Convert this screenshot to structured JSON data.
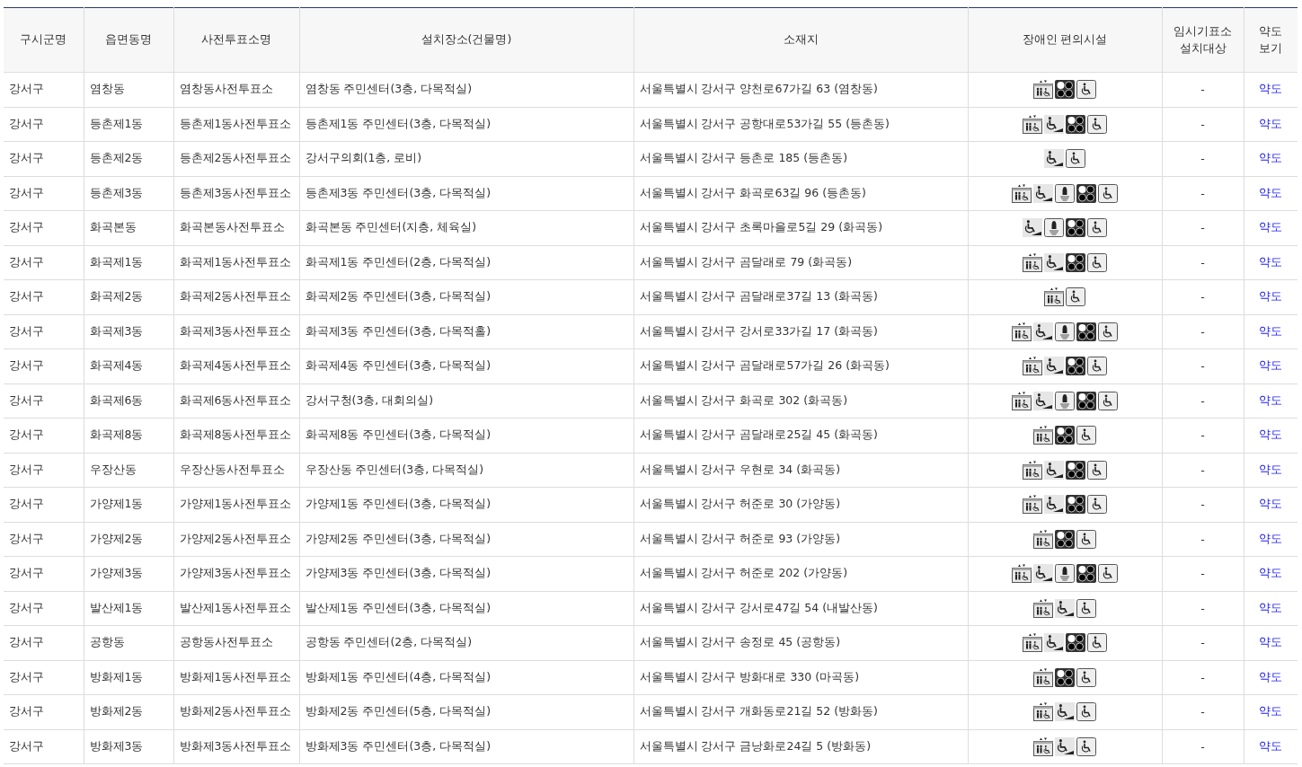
{
  "table": {
    "columns": [
      "구시군명",
      "읍면동명",
      "사전투표소명",
      "설치장소(건물명)",
      "소재지",
      "장애인 편의시설",
      "임시기표소\n설치대상",
      "약도\n보기"
    ],
    "rows": [
      {
        "district": "강서구",
        "dong": "염창동",
        "station": "염창동사전투표소",
        "place": "염창동 주민센터(3층, 다목적실)",
        "address": "서울특별시 강서구 양천로67가길 63 (염창동)",
        "facilities": [
          {
            "kind": "elevator"
          },
          {
            "kind": "braille"
          },
          {
            "kind": "toilet"
          }
        ],
        "temporary": "-",
        "map": "약도"
      },
      {
        "district": "강서구",
        "dong": "등촌제1동",
        "station": "등촌제1동사전투표소",
        "place": "등촌제1동 주민센터(3층, 다목적실)",
        "address": "서울특별시 강서구 공항대로53가길 55 (등촌동)",
        "facilities": [
          {
            "kind": "elevator"
          },
          {
            "kind": "ramp"
          },
          {
            "kind": "braille"
          },
          {
            "kind": "toilet"
          }
        ],
        "temporary": "-",
        "map": "약도"
      },
      {
        "district": "강서구",
        "dong": "등촌제2동",
        "station": "등촌제2동사전투표소",
        "place": "강서구의회(1층, 로비)",
        "address": "서울특별시 강서구 등촌로 185 (등촌동)",
        "facilities": [
          {
            "kind": "ramp"
          },
          {
            "kind": "toilet"
          }
        ],
        "temporary": "-",
        "map": "약도"
      },
      {
        "district": "강서구",
        "dong": "등촌제3동",
        "station": "등촌제3동사전투표소",
        "place": "등촌제3동 주민센터(3층, 다목적실)",
        "address": "서울특별시 강서구 화곡로63길 96 (등촌동)",
        "facilities": [
          {
            "kind": "elevator"
          },
          {
            "kind": "ramp"
          },
          {
            "kind": "bell"
          },
          {
            "kind": "braille"
          },
          {
            "kind": "toilet"
          }
        ],
        "temporary": "-",
        "map": "약도"
      },
      {
        "district": "강서구",
        "dong": "화곡본동",
        "station": "화곡본동사전투표소",
        "place": "화곡본동 주민센터(지층, 체육실)",
        "address": "서울특별시 강서구 초록마을로5길 29 (화곡동)",
        "facilities": [
          {
            "kind": "ramp"
          },
          {
            "kind": "bell"
          },
          {
            "kind": "braille"
          },
          {
            "kind": "toilet"
          }
        ],
        "temporary": "-",
        "map": "약도"
      },
      {
        "district": "강서구",
        "dong": "화곡제1동",
        "station": "화곡제1동사전투표소",
        "place": "화곡제1동 주민센터(2층, 다목적실)",
        "address": "서울특별시 강서구 곰달래로 79 (화곡동)",
        "facilities": [
          {
            "kind": "elevator"
          },
          {
            "kind": "ramp"
          },
          {
            "kind": "braille"
          },
          {
            "kind": "toilet"
          }
        ],
        "temporary": "-",
        "map": "약도"
      },
      {
        "district": "강서구",
        "dong": "화곡제2동",
        "station": "화곡제2동사전투표소",
        "place": "화곡제2동 주민센터(3층, 다목적실)",
        "address": "서울특별시 강서구 곰달래로37길 13 (화곡동)",
        "facilities": [
          {
            "kind": "elevator"
          },
          {
            "kind": "toilet"
          }
        ],
        "temporary": "-",
        "map": "약도"
      },
      {
        "district": "강서구",
        "dong": "화곡제3동",
        "station": "화곡제3동사전투표소",
        "place": "화곡제3동 주민센터(3층, 다목적홀)",
        "address": "서울특별시 강서구 강서로33가길 17 (화곡동)",
        "facilities": [
          {
            "kind": "elevator"
          },
          {
            "kind": "ramp"
          },
          {
            "kind": "bell"
          },
          {
            "kind": "braille"
          },
          {
            "kind": "toilet"
          }
        ],
        "temporary": "-",
        "map": "약도"
      },
      {
        "district": "강서구",
        "dong": "화곡제4동",
        "station": "화곡제4동사전투표소",
        "place": "화곡제4동 주민센터(3층, 다목적실)",
        "address": "서울특별시 강서구 곰달래로57가길 26 (화곡동)",
        "facilities": [
          {
            "kind": "elevator"
          },
          {
            "kind": "ramp"
          },
          {
            "kind": "braille"
          },
          {
            "kind": "toilet"
          }
        ],
        "temporary": "-",
        "map": "약도"
      },
      {
        "district": "강서구",
        "dong": "화곡제6동",
        "station": "화곡제6동사전투표소",
        "place": "강서구청(3층, 대회의실)",
        "address": "서울특별시 강서구 화곡로 302 (화곡동)",
        "facilities": [
          {
            "kind": "elevator"
          },
          {
            "kind": "ramp"
          },
          {
            "kind": "bell"
          },
          {
            "kind": "braille"
          },
          {
            "kind": "toilet"
          }
        ],
        "temporary": "-",
        "map": "약도"
      },
      {
        "district": "강서구",
        "dong": "화곡제8동",
        "station": "화곡제8동사전투표소",
        "place": "화곡제8동 주민센터(3층, 다목적실)",
        "address": "서울특별시 강서구 곰달래로25길 45 (화곡동)",
        "facilities": [
          {
            "kind": "elevator"
          },
          {
            "kind": "braille"
          },
          {
            "kind": "toilet"
          }
        ],
        "temporary": "-",
        "map": "약도"
      },
      {
        "district": "강서구",
        "dong": "우장산동",
        "station": "우장산동사전투표소",
        "place": "우장산동 주민센터(3층, 다목적실)",
        "address": "서울특별시 강서구 우현로 34 (화곡동)",
        "facilities": [
          {
            "kind": "elevator"
          },
          {
            "kind": "ramp"
          },
          {
            "kind": "braille"
          },
          {
            "kind": "toilet"
          }
        ],
        "temporary": "-",
        "map": "약도"
      },
      {
        "district": "강서구",
        "dong": "가양제1동",
        "station": "가양제1동사전투표소",
        "place": "가양제1동 주민센터(3층, 다목적실)",
        "address": "서울특별시 강서구 허준로 30 (가양동)",
        "facilities": [
          {
            "kind": "elevator"
          },
          {
            "kind": "ramp"
          },
          {
            "kind": "braille"
          },
          {
            "kind": "toilet"
          }
        ],
        "temporary": "-",
        "map": "약도"
      },
      {
        "district": "강서구",
        "dong": "가양제2동",
        "station": "가양제2동사전투표소",
        "place": "가양제2동 주민센터(3층, 다목적실)",
        "address": "서울특별시 강서구 허준로 93 (가양동)",
        "facilities": [
          {
            "kind": "elevator"
          },
          {
            "kind": "braille"
          },
          {
            "kind": "toilet"
          }
        ],
        "temporary": "-",
        "map": "약도"
      },
      {
        "district": "강서구",
        "dong": "가양제3동",
        "station": "가양제3동사전투표소",
        "place": "가양제3동 주민센터(3층, 다목적실)",
        "address": "서울특별시 강서구 허준로 202 (가양동)",
        "facilities": [
          {
            "kind": "elevator"
          },
          {
            "kind": "ramp"
          },
          {
            "kind": "bell"
          },
          {
            "kind": "braille"
          },
          {
            "kind": "toilet"
          }
        ],
        "temporary": "-",
        "map": "약도"
      },
      {
        "district": "강서구",
        "dong": "발산제1동",
        "station": "발산제1동사전투표소",
        "place": "발산제1동 주민센터(3층, 다목적실)",
        "address": "서울특별시 강서구 강서로47길 54 (내발산동)",
        "facilities": [
          {
            "kind": "elevator"
          },
          {
            "kind": "ramp"
          },
          {
            "kind": "toilet"
          }
        ],
        "temporary": "-",
        "map": "약도"
      },
      {
        "district": "강서구",
        "dong": "공항동",
        "station": "공항동사전투표소",
        "place": "공항동 주민센터(2층, 다목적실)",
        "address": "서울특별시 강서구 송정로 45 (공항동)",
        "facilities": [
          {
            "kind": "elevator"
          },
          {
            "kind": "ramp"
          },
          {
            "kind": "braille"
          },
          {
            "kind": "toilet"
          }
        ],
        "temporary": "-",
        "map": "약도"
      },
      {
        "district": "강서구",
        "dong": "방화제1동",
        "station": "방화제1동사전투표소",
        "place": "방화제1동 주민센터(4층, 다목적실)",
        "address": "서울특별시 강서구 방화대로 330 (마곡동)",
        "facilities": [
          {
            "kind": "elevator"
          },
          {
            "kind": "braille"
          },
          {
            "kind": "toilet"
          }
        ],
        "temporary": "-",
        "map": "약도"
      },
      {
        "district": "강서구",
        "dong": "방화제2동",
        "station": "방화제2동사전투표소",
        "place": "방화제2동 주민센터(5층, 다목적실)",
        "address": "서울특별시 강서구 개화동로21길 52 (방화동)",
        "facilities": [
          {
            "kind": "elevator"
          },
          {
            "kind": "ramp"
          },
          {
            "kind": "toilet"
          }
        ],
        "temporary": "-",
        "map": "약도"
      },
      {
        "district": "강서구",
        "dong": "방화제3동",
        "station": "방화제3동사전투표소",
        "place": "방화제3동 주민센터(3층, 다목적실)",
        "address": "서울특별시 강서구 금낭화로24길 5 (방화동)",
        "facilities": [
          {
            "kind": "elevator"
          },
          {
            "kind": "ramp"
          },
          {
            "kind": "toilet"
          }
        ],
        "temporary": "-",
        "map": "약도"
      }
    ]
  }
}
